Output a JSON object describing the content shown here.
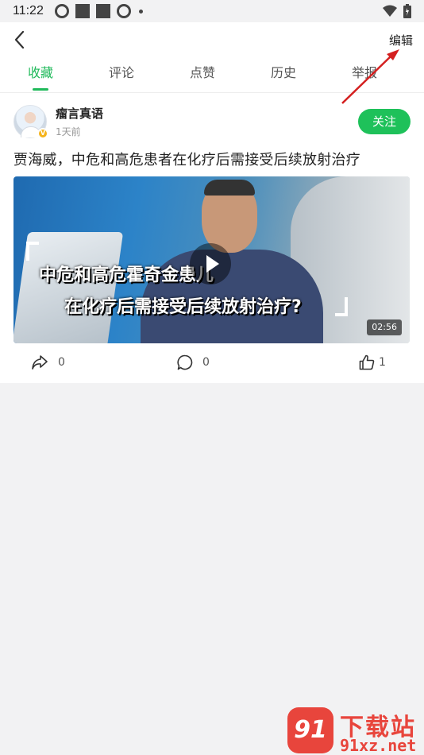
{
  "status_bar": {
    "time": "11:22"
  },
  "header": {
    "edit_label": "编辑"
  },
  "tabs": [
    {
      "label": "收藏",
      "active": true
    },
    {
      "label": "评论",
      "active": false
    },
    {
      "label": "点赞",
      "active": false
    },
    {
      "label": "历史",
      "active": false
    },
    {
      "label": "举报",
      "active": false
    }
  ],
  "post": {
    "author_name": "瘤言真语",
    "author_badge": "V",
    "time_ago": "1天前",
    "follow_label": "关注",
    "title": "贾海威，中危和高危患者在化疗后需接受后续放射治疗",
    "video": {
      "caption_line1": "中危和高危霍奇金患儿",
      "caption_line2": "在化疗后需接受后续放射治疗?",
      "duration": "02:56"
    },
    "share_count": "0",
    "comment_count": "0",
    "like_count": "1"
  },
  "watermark": {
    "logo_text": "91",
    "title": "下载站",
    "url": "91xz.net"
  },
  "colors": {
    "accent": "#1fb95a",
    "annotation_arrow": "#d42020"
  }
}
